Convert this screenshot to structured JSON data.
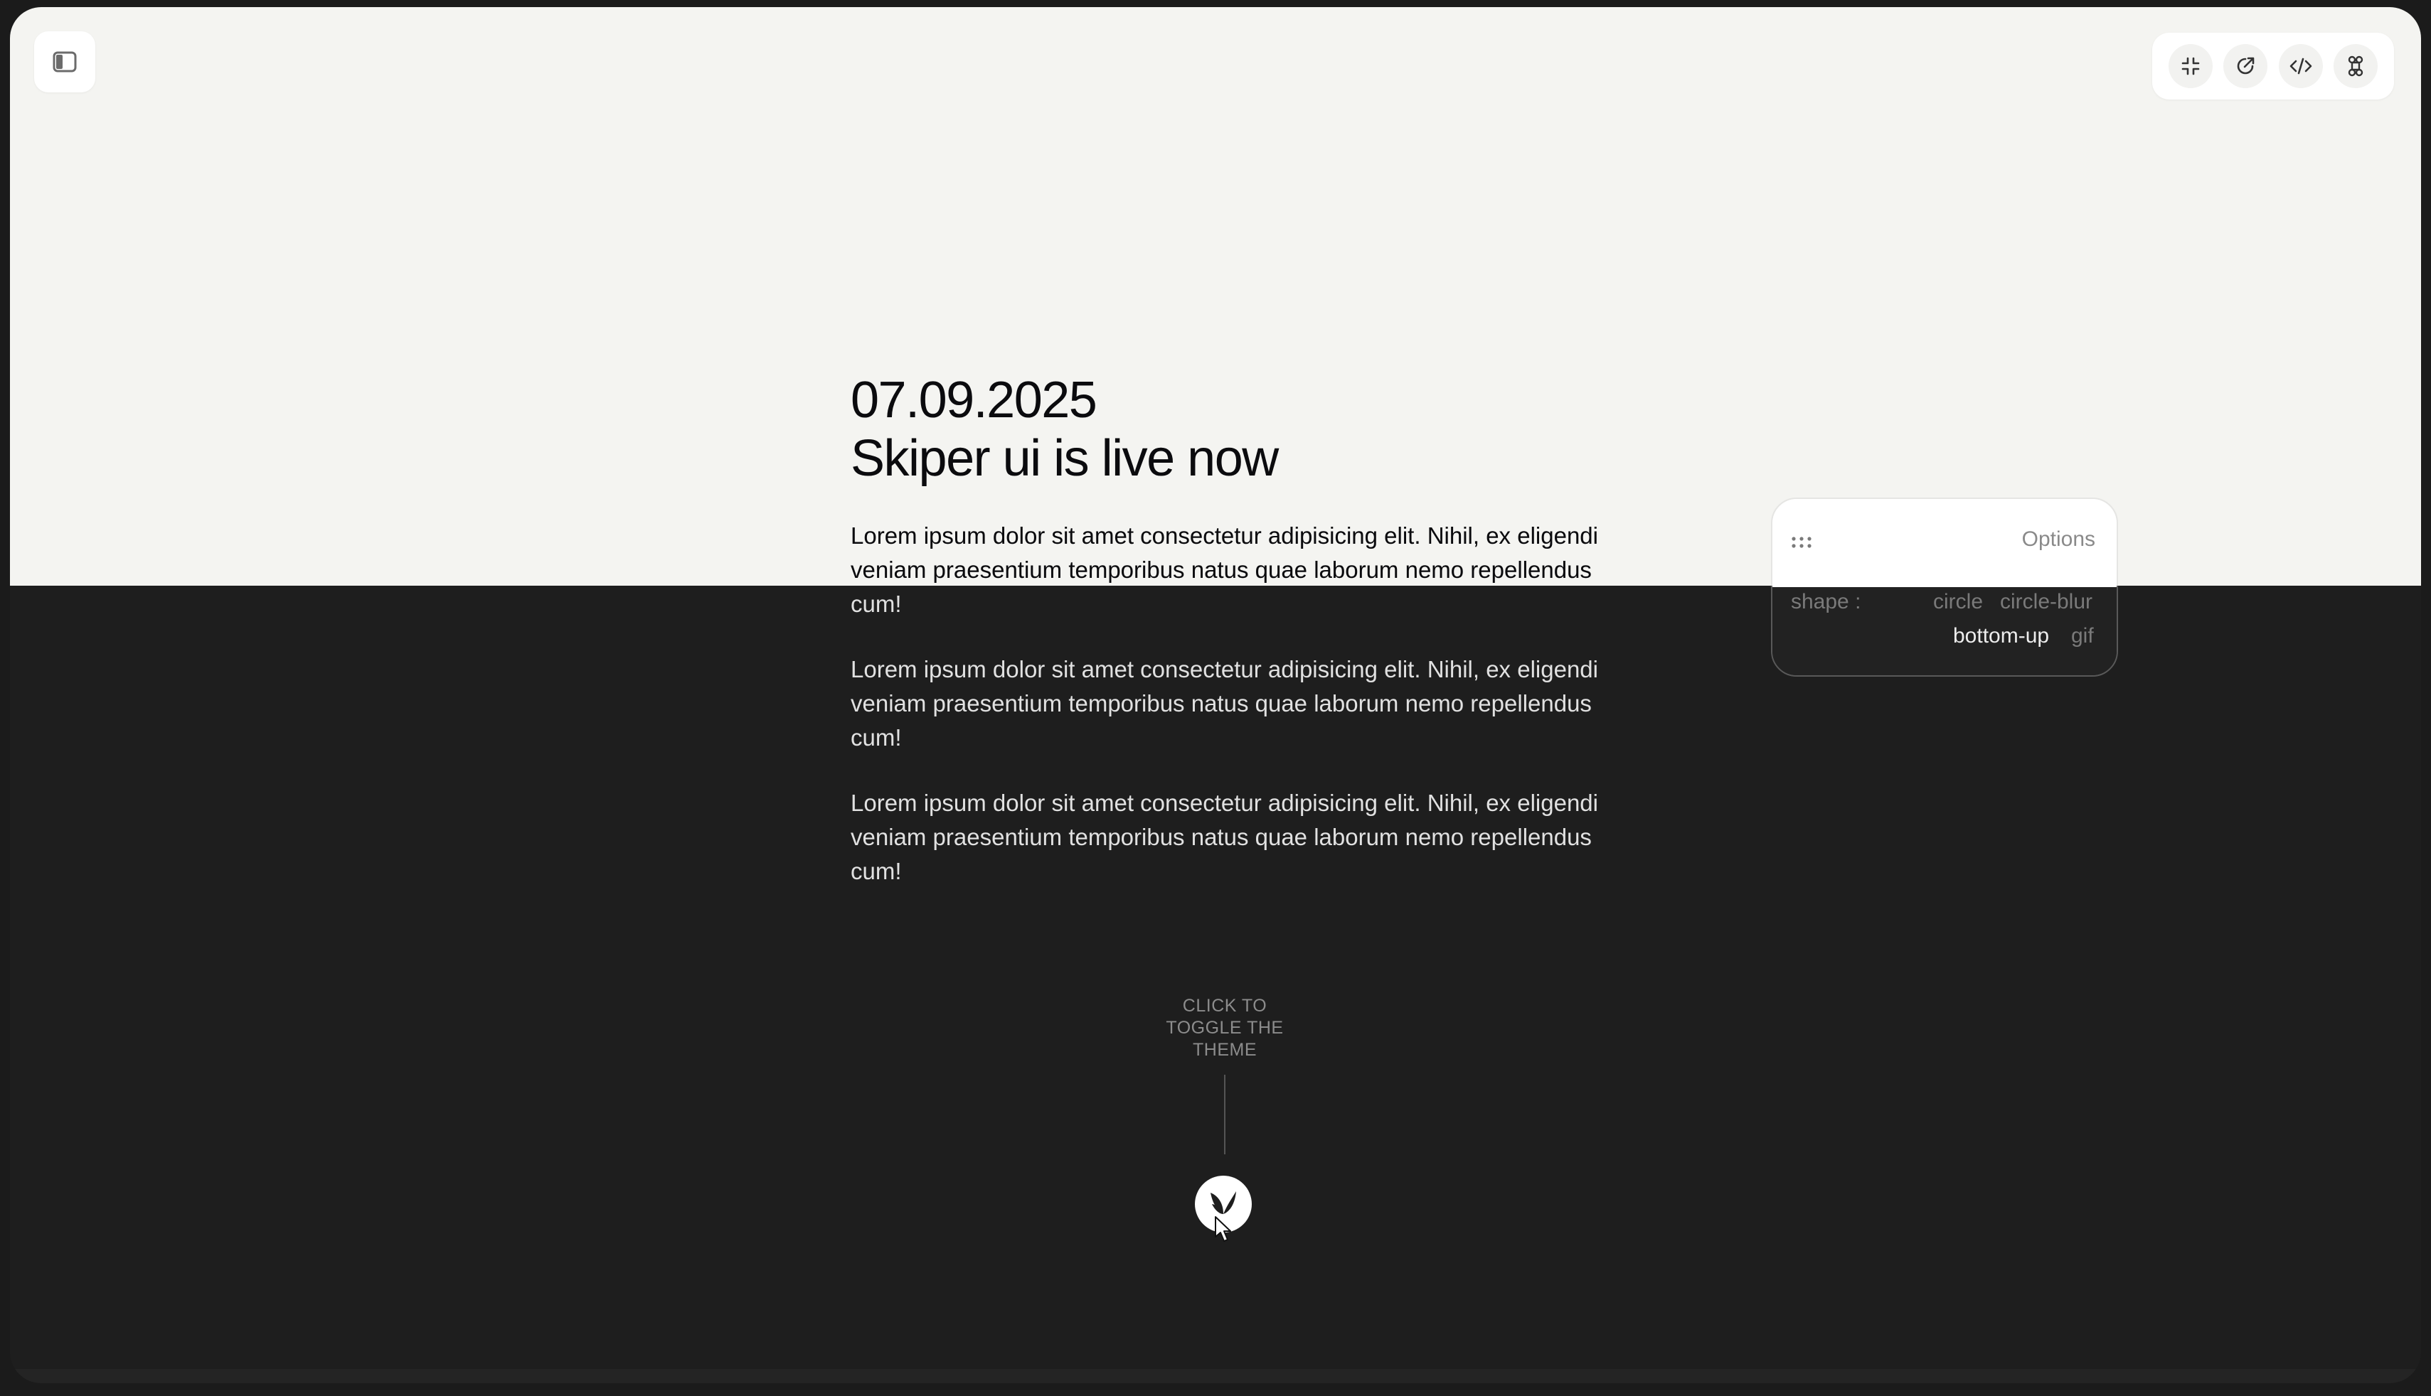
{
  "header": {
    "sidebar_toggle_icon": "sidebar-icon",
    "toolbar": [
      {
        "icon": "collapse-icon",
        "label": "Collapse"
      },
      {
        "icon": "external-link-icon",
        "label": "Open"
      },
      {
        "icon": "code-icon",
        "label": "Code"
      },
      {
        "icon": "command-icon",
        "label": "Command"
      }
    ]
  },
  "article": {
    "date": "07.09.2025",
    "headline": "Skiper ui is live now",
    "paragraphs": [
      "Lorem ipsum dolor sit amet consectetur adipisicing elit. Nihil, ex eligendi veniam praesentium temporibus natus quae laborum nemo repellendus cum!",
      "Lorem ipsum dolor sit amet consectetur adipisicing elit. Nihil, ex eligendi veniam praesentium temporibus natus quae laborum nemo repellendus cum!",
      "Lorem ipsum dolor sit amet consectetur adipisicing elit. Nihil, ex eligendi veniam praesentium temporibus natus quae laborum nemo repellendus cum!"
    ]
  },
  "options_panel": {
    "title": "Options",
    "shape_label": "shape :",
    "shapes": [
      "circle",
      "circle-blur",
      "bottom-up",
      "gif"
    ],
    "selected_shape": "bottom-up"
  },
  "theme_toggle": {
    "hint_line1": "CLICK TO",
    "hint_line2": "TOGGLE THE",
    "hint_line3": "THEME",
    "icon": "theme-toggle-icon"
  },
  "colors": {
    "light_bg": "#f4f4f1",
    "dark_bg": "#1e1e1e",
    "text_dark": "#1a1a1a",
    "muted": "#8a8a8a"
  }
}
